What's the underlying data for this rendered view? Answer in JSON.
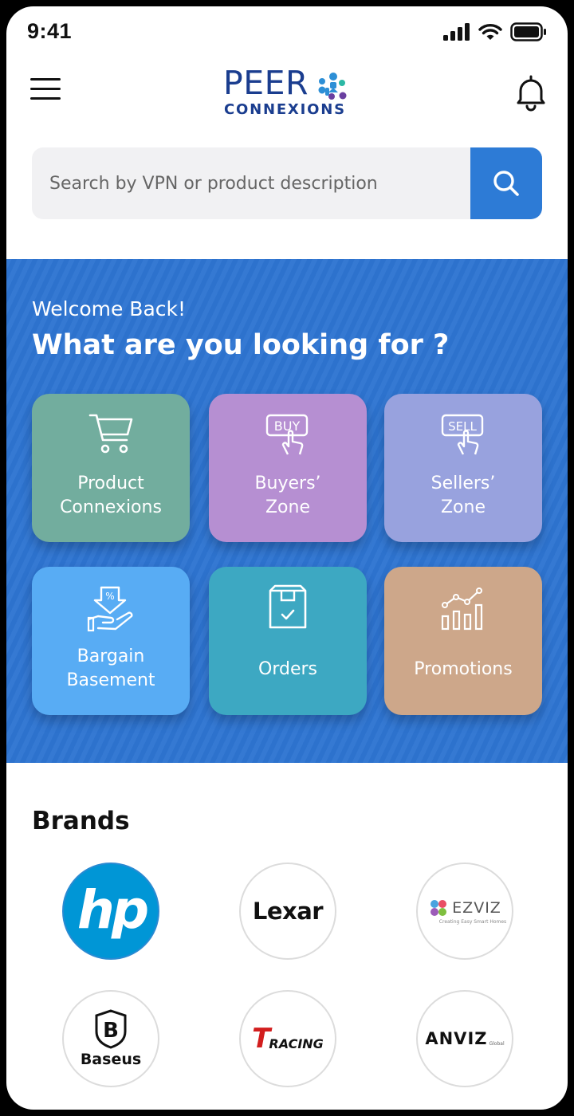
{
  "status_bar": {
    "time": "9:41"
  },
  "header": {
    "logo_line1": "PEER",
    "logo_line2": "CONNEXIONS"
  },
  "search": {
    "placeholder": "Search by VPN or product description"
  },
  "hero": {
    "welcome": "Welcome Back!",
    "heading": "What are you looking for ?",
    "tiles": [
      {
        "label_line1": "Product",
        "label_line2": "Connexions",
        "color": "#72ad9e",
        "icon": "cart-icon"
      },
      {
        "label_line1": "Buyers’",
        "label_line2": "Zone",
        "color": "#b68fd2",
        "icon": "buy-button-icon",
        "icon_text": "BUY"
      },
      {
        "label_line1": "Sellers’",
        "label_line2": "Zone",
        "color": "#98a2de",
        "icon": "sell-button-icon",
        "icon_text": "SELL"
      },
      {
        "label_line1": "Bargain",
        "label_line2": "Basement",
        "color": "#58acf4",
        "icon": "discount-hand-icon"
      },
      {
        "label_line1": "Orders",
        "color": "#3da8c2",
        "icon": "box-icon"
      },
      {
        "label_line1": "Promotions",
        "color": "#cda78a",
        "icon": "growth-chart-icon"
      }
    ]
  },
  "brands": {
    "title": "Brands",
    "items": [
      {
        "name": "hp"
      },
      {
        "name": "Lexar"
      },
      {
        "name": "EZVIZ",
        "tagline": "Creating Easy Smart Homes"
      },
      {
        "name": "Baseus"
      },
      {
        "name": "RACING",
        "mark": "T"
      },
      {
        "name": "ANVIZ",
        "tagline": "Global"
      }
    ]
  },
  "colors": {
    "accent": "#2d7bd6",
    "panel": "#2e74d1",
    "logo": "#1a3d8f"
  }
}
